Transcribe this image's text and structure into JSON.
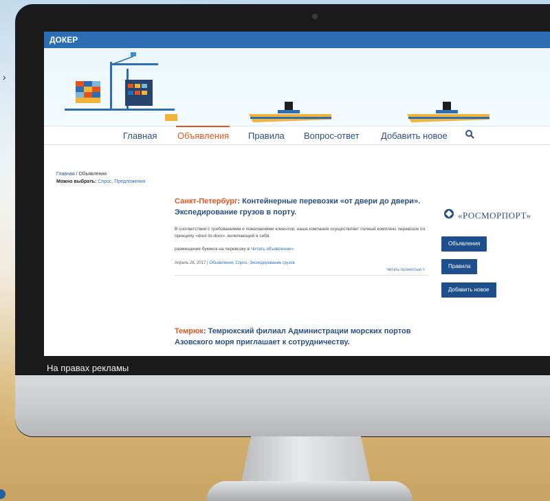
{
  "site": {
    "brand": "ДОКЕР",
    "nav": [
      {
        "label": "Главная"
      },
      {
        "label": "Объявления"
      },
      {
        "label": "Правила"
      },
      {
        "label": "Вопрос-ответ"
      },
      {
        "label": "Добавить новое"
      }
    ],
    "active_nav_index": 1,
    "accent_color": "#e0551f",
    "header_color": "#2d6db4"
  },
  "breadcrumb": {
    "home": "Главная",
    "sep": "/",
    "current": "Объявления"
  },
  "filter": {
    "label": "Можно выбрать:",
    "options": "Спрос, Предложения"
  },
  "article1": {
    "city": "Санкт-Петербург",
    "title": "Контейнерные перевозки «от двери до двери». Экспедирование грузов в порту.",
    "body": "В соответствии с требованиями и пожеланиями клиентов, наша компания осуществляет полный комплекс перевозок по принципу «door-to-door», включающий в себя:",
    "line2_text": "размещение букинга на перевозку в",
    "line2_link": "Читать объявление»",
    "meta_date": "Апрель 26, 2017",
    "meta_sep": "|",
    "meta_tags": "Объявления, Спрос, Экспедирование грузов",
    "read_more": "Читать полностью >"
  },
  "article2": {
    "city": "Темрюк",
    "title": "Темрюкский филиал Администрации морских портов Азовского моря приглашает к сотрудничеству."
  },
  "sidebar": {
    "logo_text": "«РОСМОРПОРТ»",
    "buttons": [
      {
        "label": "Объявления"
      },
      {
        "label": "Правила"
      },
      {
        "label": "Добавить новое"
      }
    ]
  },
  "ad_caption": "На правах рекламы"
}
